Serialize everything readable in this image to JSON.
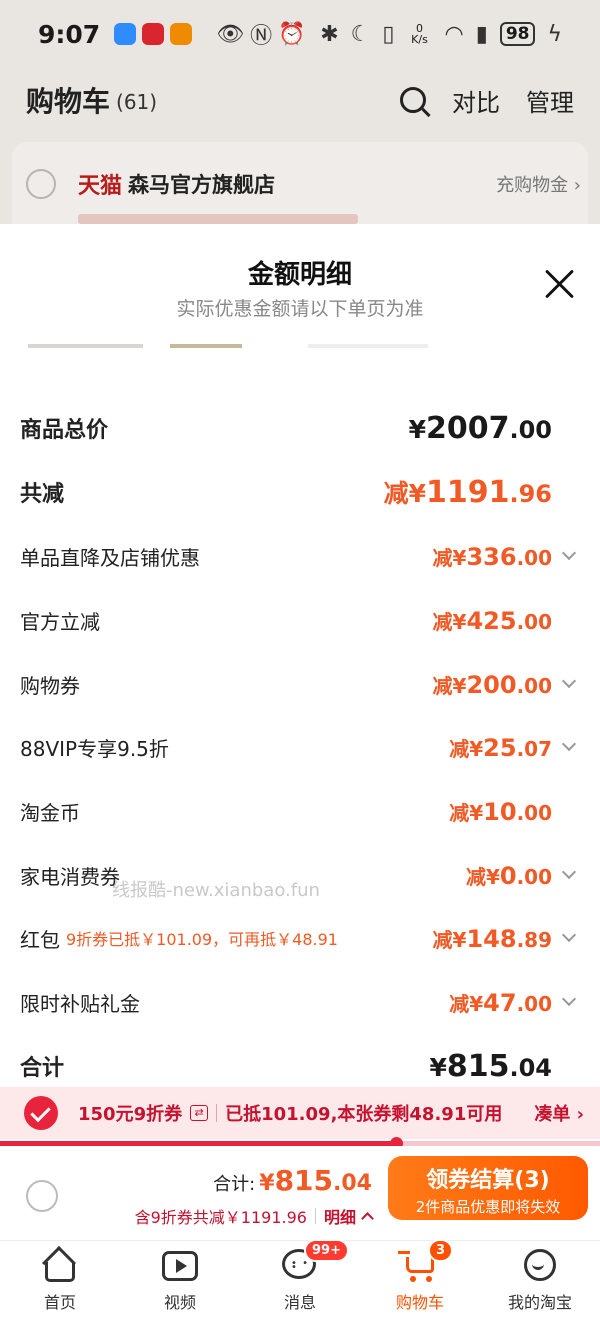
{
  "status_bar": {
    "time": "9:07",
    "network_speed": "0 K/s",
    "battery": "98"
  },
  "cart_header": {
    "title": "购物车",
    "count": "(61)",
    "compare": "对比",
    "manage": "管理"
  },
  "store": {
    "brand": "天猫",
    "name": "森马官方旗舰店",
    "link": "充购物金 ›"
  },
  "sheet": {
    "title": "金额明细",
    "subtitle": "实际优惠金额请以下单页为准",
    "rows": [
      {
        "label": "商品总价",
        "prefix": "",
        "currency": "¥",
        "int": "2007",
        "dec": ".00"
      },
      {
        "label": "共减",
        "prefix": "减",
        "currency": "¥",
        "int": "1191",
        "dec": ".96"
      },
      {
        "label": "单品直降及店铺优惠",
        "prefix": "减",
        "currency": "¥",
        "int": "336",
        "dec": ".00"
      },
      {
        "label": "官方立减",
        "prefix": "减",
        "currency": "¥",
        "int": "425",
        "dec": ".00"
      },
      {
        "label": "购物券",
        "prefix": "减",
        "currency": "¥",
        "int": "200",
        "dec": ".00"
      },
      {
        "label": "88VIP专享9.5折",
        "prefix": "减",
        "currency": "¥",
        "int": "25",
        "dec": ".07"
      },
      {
        "label": "淘金币",
        "prefix": "减",
        "currency": "¥",
        "int": "10",
        "dec": ".00"
      },
      {
        "label": "家电消费券",
        "prefix": "减",
        "currency": "¥",
        "int": "0",
        "dec": ".00"
      },
      {
        "label": "红包",
        "note": "9折券已抵￥101.09，可再抵￥48.91",
        "prefix": "减",
        "currency": "¥",
        "int": "148",
        "dec": ".89"
      },
      {
        "label": "限时补贴礼金",
        "prefix": "减",
        "currency": "¥",
        "int": "47",
        "dec": ".00"
      },
      {
        "label": "合计",
        "prefix": "",
        "currency": "¥",
        "int": "815",
        "dec": ".04"
      }
    ],
    "watermark": "线报酷-new.xianbao.fun"
  },
  "coupon_bar": {
    "name": "150元9折券",
    "swap_symbol": "⇄",
    "info": "已抵101.09,本张券剩48.91可用",
    "link": "凑单 ›",
    "progress": 0.66
  },
  "checkout": {
    "total_label": "合计:",
    "currency": "¥",
    "total_int": "815",
    "total_dec": ".04",
    "discount_text": "含9折券共减￥1191.96",
    "detail_label": "明细",
    "button_label": "领券结算(3)",
    "button_sub": "2件商品优惠即将失效"
  },
  "tabbar": {
    "tabs": [
      {
        "label": "首页"
      },
      {
        "label": "视频"
      },
      {
        "label": "消息",
        "badge": "99+"
      },
      {
        "label": "购物车",
        "badge": "3"
      },
      {
        "label": "我的淘宝"
      }
    ]
  },
  "colors": {
    "accent": "#f15a24",
    "coupon_red": "#c4122f",
    "active_tab": "#ff5000"
  }
}
